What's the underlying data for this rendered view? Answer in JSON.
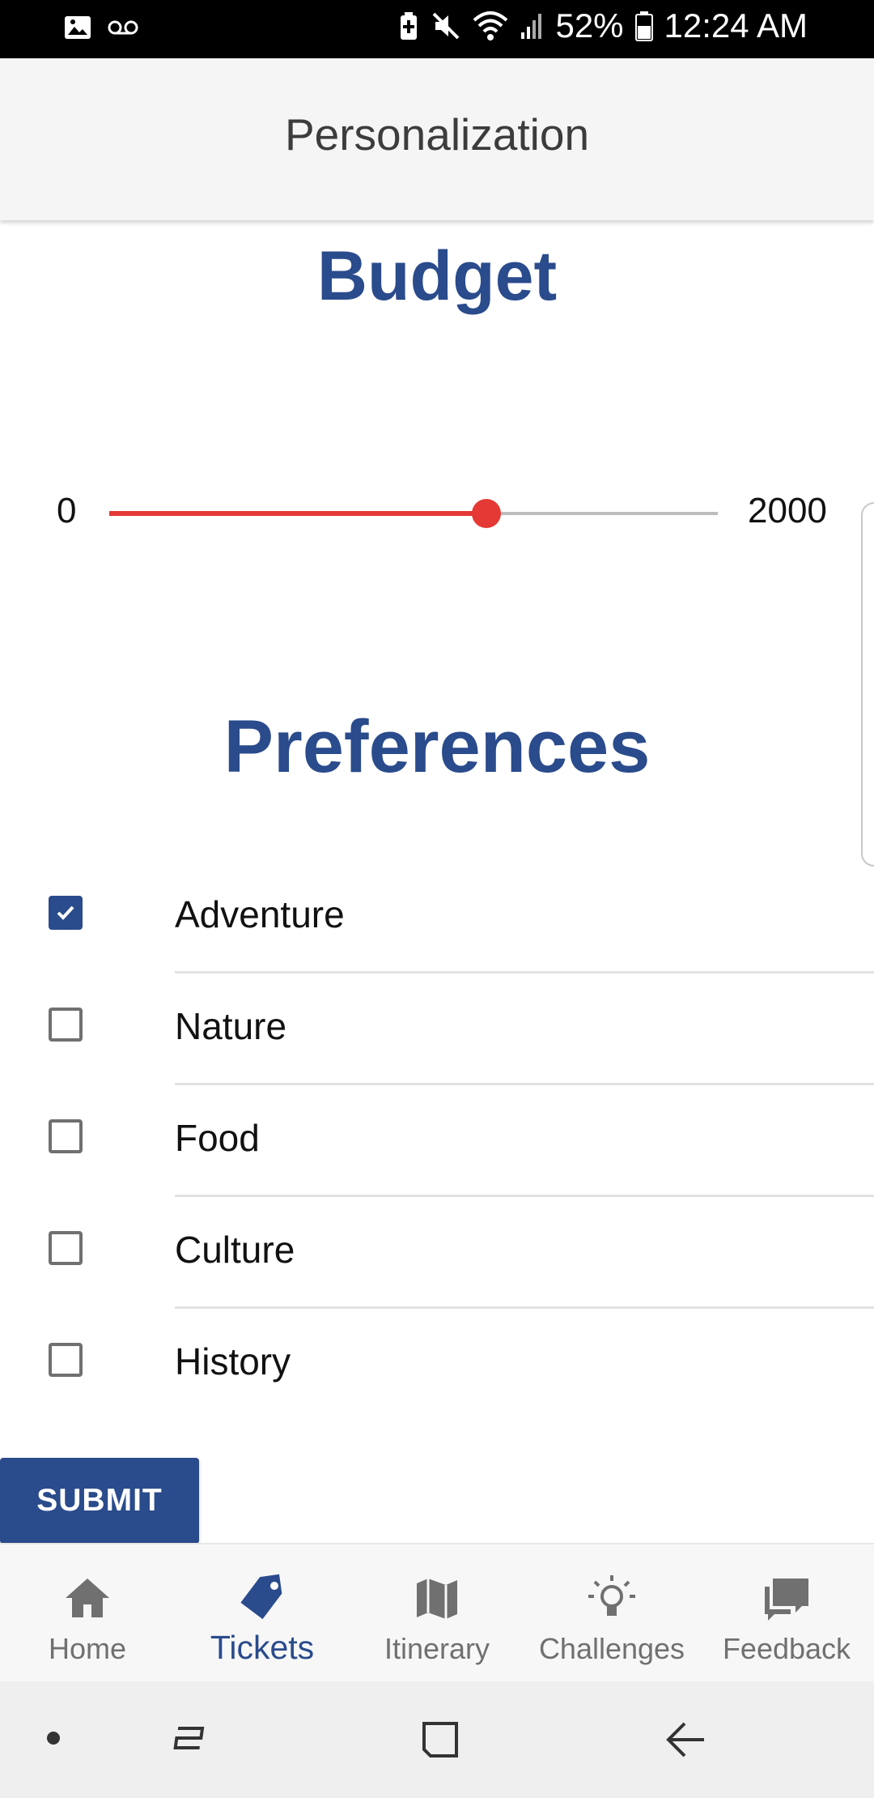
{
  "status_bar": {
    "battery": "52%",
    "time": "12:24 AM"
  },
  "app_bar": {
    "title": "Personalization"
  },
  "budget": {
    "title": "Budget",
    "min_label": "0",
    "max_label": "2000",
    "value_fraction": 0.62
  },
  "preferences": {
    "title": "Preferences",
    "items": [
      {
        "label": "Adventure",
        "checked": true
      },
      {
        "label": "Nature",
        "checked": false
      },
      {
        "label": "Food",
        "checked": false
      },
      {
        "label": "Culture",
        "checked": false
      },
      {
        "label": "History",
        "checked": false
      }
    ]
  },
  "submit_label": "SUBMIT",
  "bottom_nav": {
    "active": "Tickets",
    "items": [
      {
        "label": "Home",
        "icon": "home-icon"
      },
      {
        "label": "Tickets",
        "icon": "ticket-tag-icon"
      },
      {
        "label": "Itinerary",
        "icon": "map-icon"
      },
      {
        "label": "Challenges",
        "icon": "lightbulb-icon"
      },
      {
        "label": "Feedback",
        "icon": "feedback-icon"
      }
    ]
  },
  "colors": {
    "accent": "#2a4b8c",
    "slider": "#e53935"
  }
}
